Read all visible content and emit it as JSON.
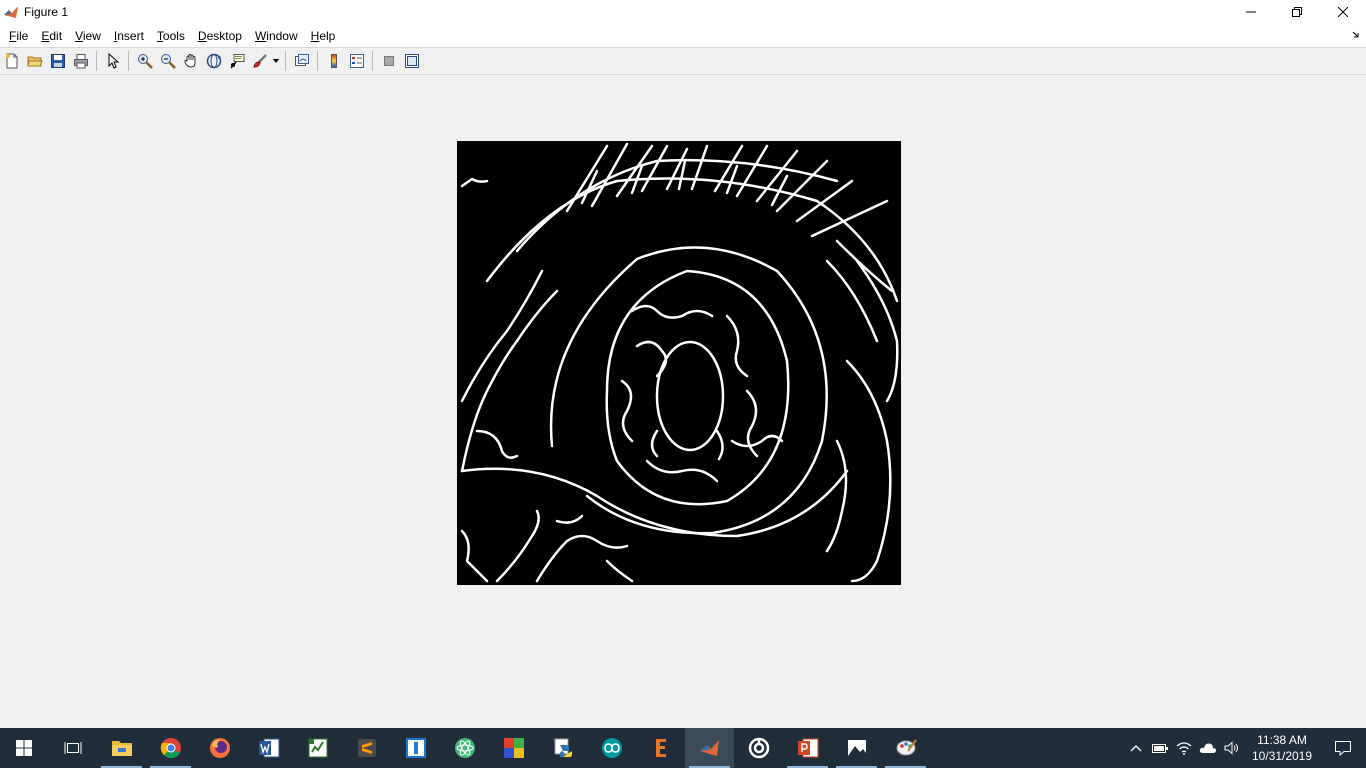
{
  "window": {
    "title": "Figure 1"
  },
  "menu": [
    "File",
    "Edit",
    "View",
    "Insert",
    "Tools",
    "Desktop",
    "Window",
    "Help"
  ],
  "toolbar": {
    "buttons": [
      "new-figure",
      "open-file",
      "save",
      "print",
      "edit-plot",
      "zoom-in",
      "zoom-out",
      "pan",
      "rotate-3d",
      "data-cursor",
      "brush",
      "link-plot",
      "insert-colorbar",
      "insert-legend",
      "hide-plot-tools",
      "show-plot-tools"
    ]
  },
  "taskbar": {
    "apps": [
      "task-view",
      "file-explorer",
      "chrome",
      "firefox",
      "word",
      "project",
      "sublime-text",
      "app-blue",
      "atom",
      "app-colored",
      "python",
      "arduino",
      "app-e",
      "matlab",
      "app-circle",
      "powerpoint",
      "photos",
      "paint"
    ],
    "active_app": "matlab",
    "time": "11:38 AM",
    "date": "10/31/2019"
  },
  "colors": {
    "figure_bg": "#f0f0f0",
    "axes_bg": "#000000",
    "edges": "#ffffff",
    "taskbar": "#1f2e3a"
  }
}
